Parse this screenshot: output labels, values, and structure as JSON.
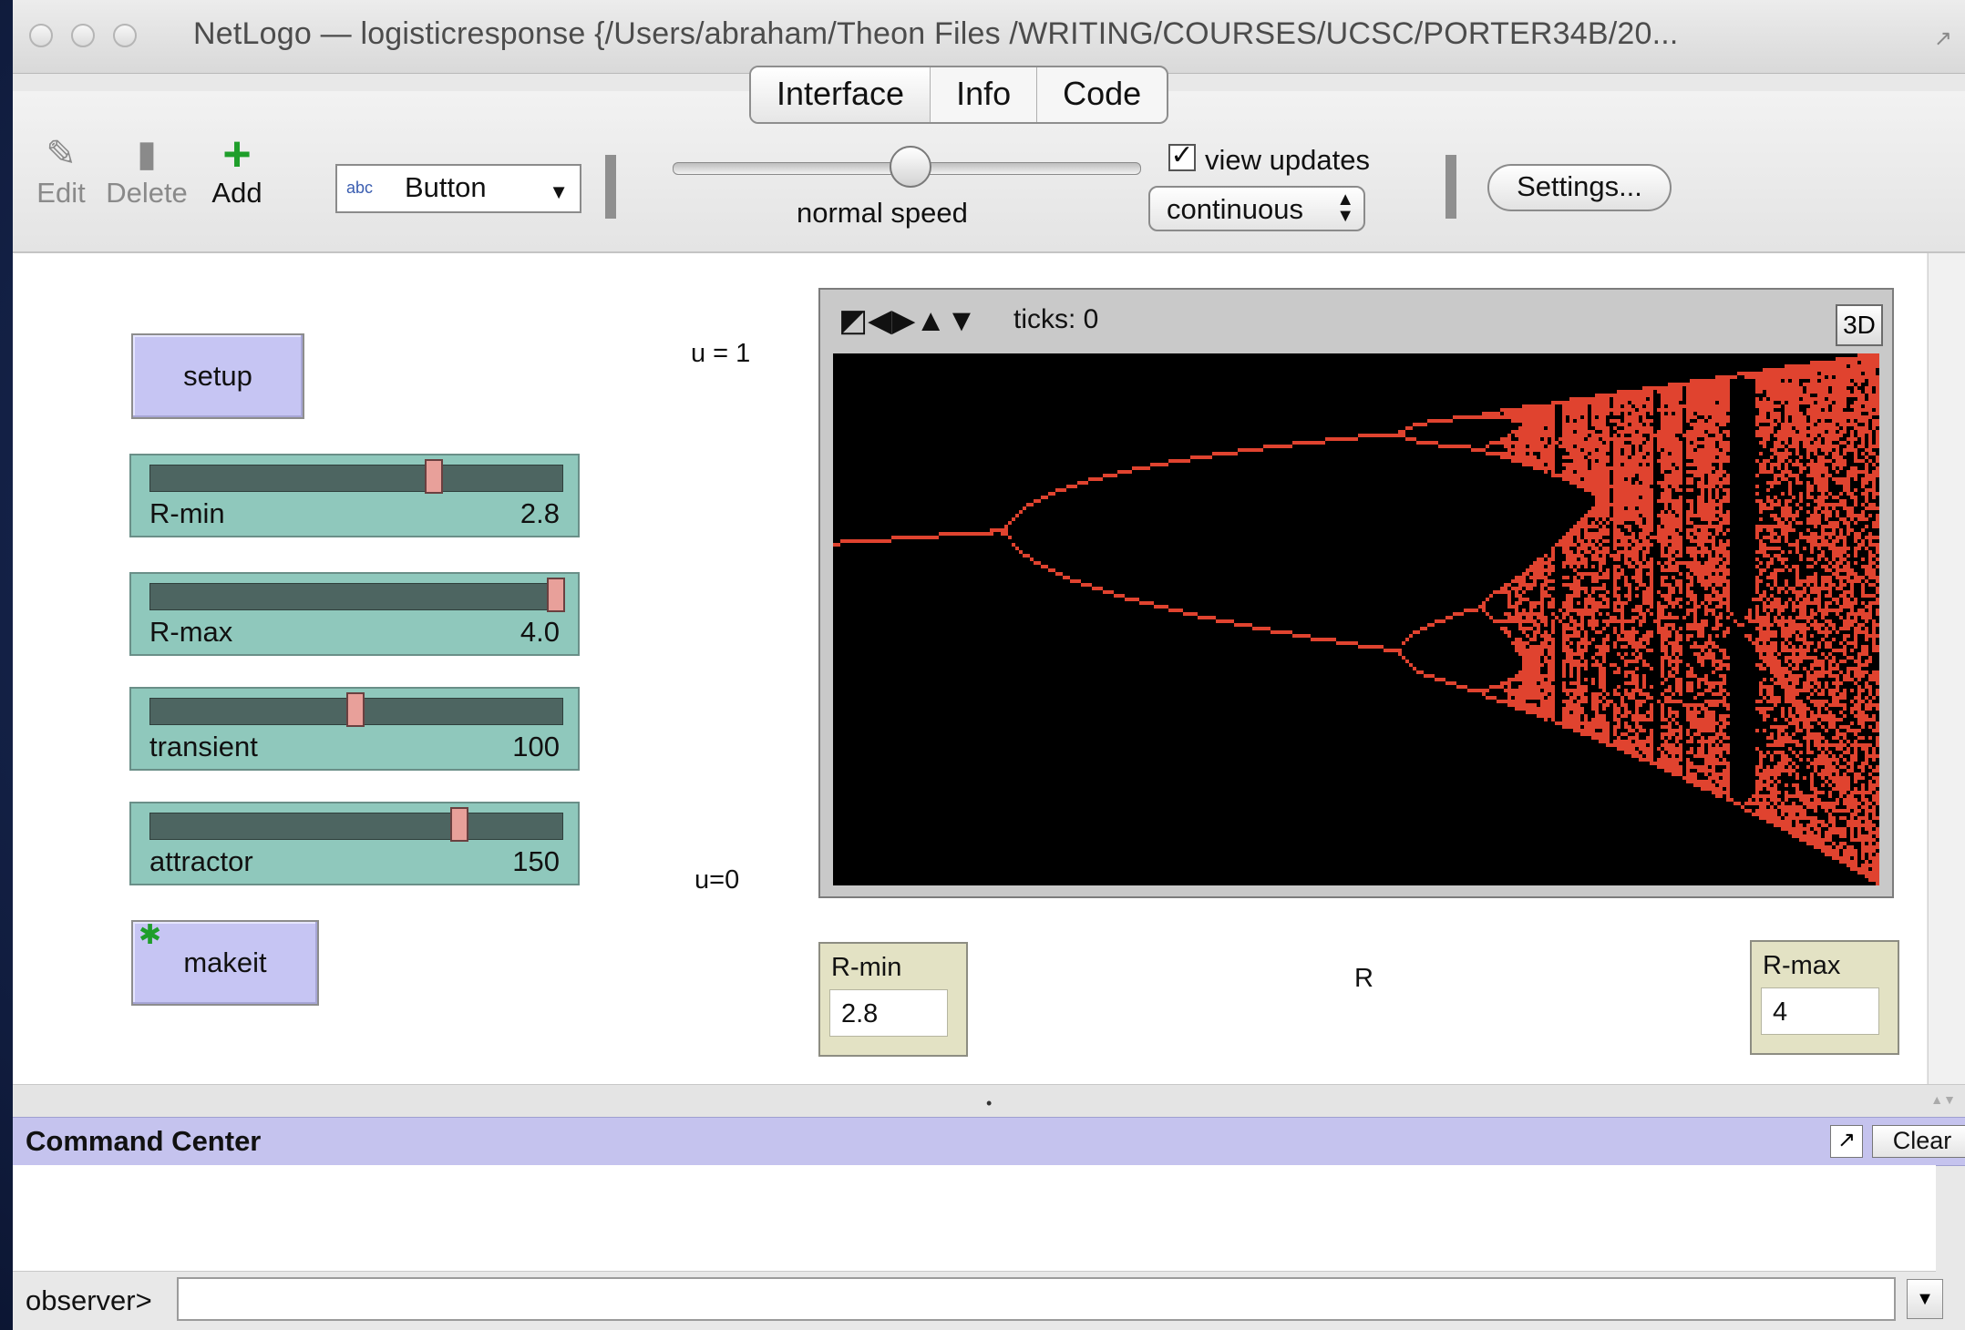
{
  "window": {
    "title": "NetLogo — logisticresponse {/Users/abraham/Theon Files /WRITING/COURSES/UCSC/PORTER34B/20...",
    "resize_icon": "resize-corner-icon"
  },
  "tabs": [
    {
      "label": "Interface",
      "active": true
    },
    {
      "label": "Info",
      "active": false
    },
    {
      "label": "Code",
      "active": false
    }
  ],
  "toolbar": {
    "edit_label": "Edit",
    "delete_label": "Delete",
    "add_label": "Add",
    "widget_type": "Button",
    "widget_icon_text": "abc",
    "speed_label": "normal speed",
    "speed_level": 0.5,
    "view_updates_label": "view updates",
    "view_updates_checked": true,
    "update_mode": "continuous",
    "settings_label": "Settings..."
  },
  "interface": {
    "setup_button": "setup",
    "makeit_button": "makeit",
    "sliders": [
      {
        "name": "R-min",
        "value": "2.8",
        "level": 0.72
      },
      {
        "name": "R-max",
        "value": "4.0",
        "level": 1.0
      },
      {
        "name": "transient",
        "value": "100",
        "level": 0.5
      },
      {
        "name": "attractor",
        "value": "150",
        "level": 0.75
      }
    ],
    "label_u1": "u = 1",
    "label_u0": "u=0",
    "label_r": "R",
    "view": {
      "ticks": "ticks: 0",
      "btn_3d": "3D",
      "background": "#000000",
      "plot_color": "#e0432f"
    },
    "monitors": [
      {
        "name": "R-min",
        "value": "2.8"
      },
      {
        "name": "R-max",
        "value": "4"
      }
    ]
  },
  "command_center": {
    "title": "Command Center",
    "clear_label": "Clear",
    "prompt": "observer>",
    "input_value": ""
  },
  "colors": {
    "button": "#c6c5f3",
    "slider": "#8fc8bc",
    "monitor": "#e3e2c4",
    "command_header": "#c5c3ee"
  }
}
